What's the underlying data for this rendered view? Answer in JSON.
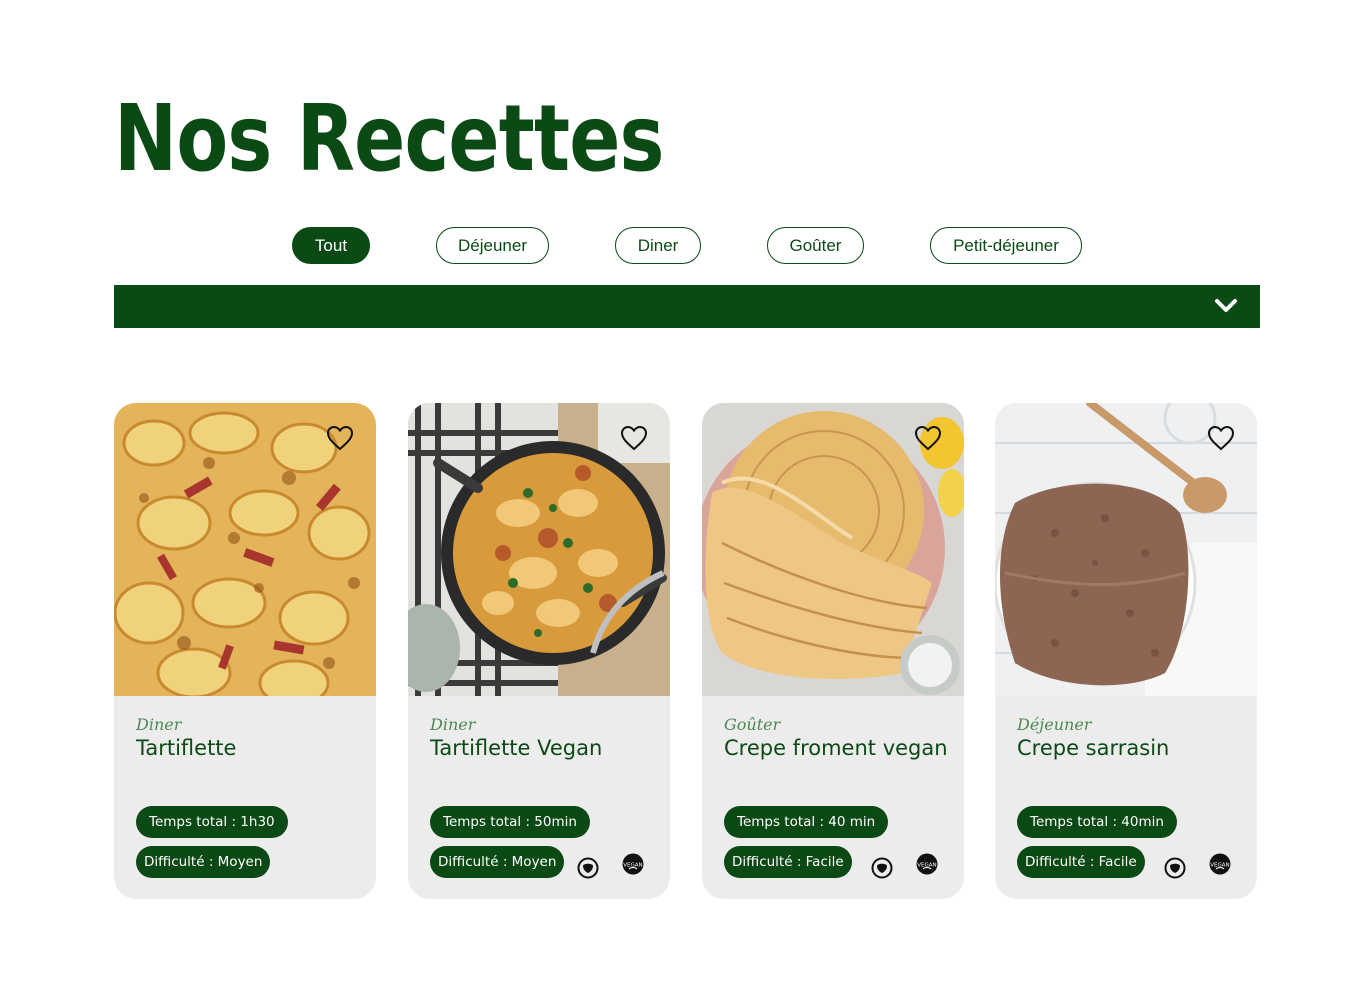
{
  "header": {
    "title": "Nos Recettes"
  },
  "filters": [
    {
      "label": "Tout",
      "active": true
    },
    {
      "label": "Déjeuner",
      "active": false
    },
    {
      "label": "Diner",
      "active": false
    },
    {
      "label": "Goûter",
      "active": false
    },
    {
      "label": "Petit-déjeuner",
      "active": false
    }
  ],
  "dropdown": {
    "icon": "chevron-down-icon"
  },
  "recipes": [
    {
      "category": "Diner",
      "name": "Tartiflette",
      "time": "Temps total : 1h30",
      "difficulty": "Difficulté : Moyen",
      "badges": []
    },
    {
      "category": "Diner",
      "name": "Tartiflette Vegan",
      "time": "Temps total : 50min",
      "difficulty": "Difficulté : Moyen",
      "badges": [
        "lactose-free-icon",
        "vegan-icon"
      ]
    },
    {
      "category": "Goûter",
      "name": "Crepe froment vegan",
      "time": "Temps total : 40 min",
      "difficulty": "Difficulté : Facile",
      "badges": [
        "lactose-free-icon",
        "vegan-icon"
      ]
    },
    {
      "category": "Déjeuner",
      "name": "Crepe sarrasin",
      "time": "Temps total : 40min",
      "difficulty": "Difficulté : Facile",
      "badges": [
        "lactose-free-icon",
        "vegan-icon"
      ]
    }
  ],
  "colors": {
    "brand_green": "#0b4a14",
    "category_green": "#4c8a50",
    "card_bg": "#ececec"
  }
}
